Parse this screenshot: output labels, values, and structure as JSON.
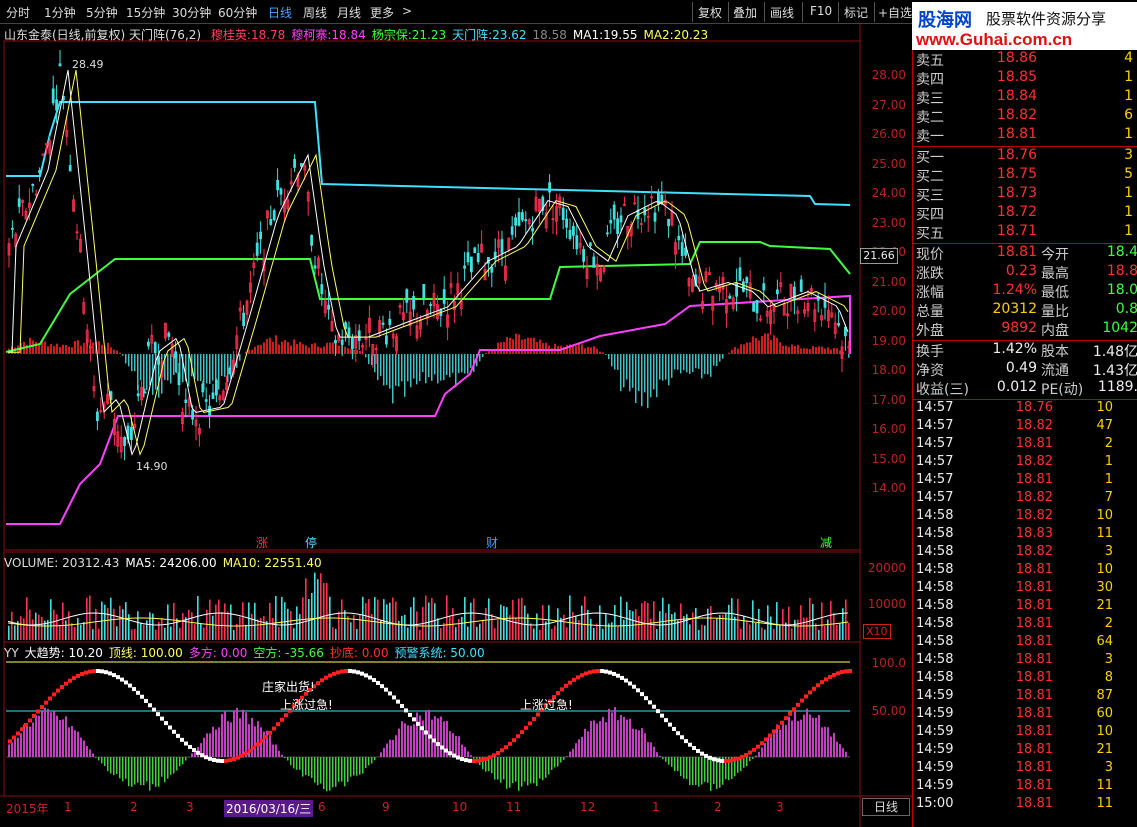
{
  "toolbar": {
    "periods": [
      "分时",
      "1分钟",
      "5分钟",
      "15分钟",
      "30分钟",
      "60分钟",
      "日线",
      "周线",
      "月线",
      "更多"
    ],
    "active_period": "日线",
    "more_arrow": ">",
    "right_buttons": [
      "复权",
      "叠加",
      "画线",
      "F10",
      "标记",
      "+自选"
    ]
  },
  "logo": {
    "brand": "股海网",
    "tagline": "股票软件资源分享",
    "url": "www.Guhai.com.cn"
  },
  "main_chart": {
    "title": "山东金泰(日线,前复权) 天门阵(76,2)",
    "indicators": [
      {
        "label": "穆桂英:",
        "value": "18.78",
        "color": "#ff4060"
      },
      {
        "label": "穆柯寨:",
        "value": "18.84",
        "color": "#ff40ff"
      },
      {
        "label": "杨宗保:",
        "value": "21.23",
        "color": "#40ff40"
      },
      {
        "label": "天门阵:",
        "value": "23.62",
        "color": "#40e0ff"
      },
      {
        "label": "",
        "value": "18.58",
        "color": "#888888"
      },
      {
        "label": "MA1:",
        "value": "19.55",
        "color": "#ffffff"
      },
      {
        "label": "MA2:",
        "value": "20.23",
        "color": "#ffff60"
      }
    ],
    "y_ticks": [
      "28.00",
      "27.00",
      "26.00",
      "25.00",
      "24.00",
      "23.00",
      "22.00",
      "21.00",
      "20.00",
      "19.00",
      "18.00",
      "17.00",
      "16.00",
      "15.00",
      "14.00"
    ],
    "high_mark": "28.49",
    "low_mark": "14.90",
    "current_price_tag": "21.66",
    "event_markers": [
      {
        "text": "涨",
        "color": "#ff3030"
      },
      {
        "text": "停",
        "color": "#40e0ff"
      },
      {
        "text": "财",
        "color": "#40a0ff"
      },
      {
        "text": "减",
        "color": "#40ff40"
      }
    ]
  },
  "volume_chart": {
    "labels": [
      {
        "text": "VOLUME: 20312.43",
        "color": "#dddddd"
      },
      {
        "text": "MA5: 24206.00",
        "color": "#ffffff"
      },
      {
        "text": "MA10: 22551.40",
        "color": "#ffff60"
      }
    ],
    "y_ticks": [
      "20000",
      "10000"
    ],
    "unit": "X10"
  },
  "yy_chart": {
    "labels": [
      {
        "text": "YY",
        "color": "#dddddd"
      },
      {
        "text": "大趋势: 10.20",
        "color": "#ffffff"
      },
      {
        "text": "顶线: 100.00",
        "color": "#ffff60"
      },
      {
        "text": "多方: 0.00",
        "color": "#ff40ff"
      },
      {
        "text": "空方: -35.66",
        "color": "#40ff40"
      },
      {
        "text": "抄底: 0.00",
        "color": "#ff3030"
      },
      {
        "text": "预警系统: 50.00",
        "color": "#40e0ff"
      }
    ],
    "y_ticks": [
      "100.0",
      "50.00"
    ],
    "annotations": [
      "庄家出货!",
      "上涨过急!",
      "上涨过急!"
    ]
  },
  "time_axis": {
    "labels": [
      "2015年",
      "1",
      "2",
      "3",
      "2016/03/16/三",
      "6",
      "9",
      "10",
      "11",
      "12",
      "1",
      "2",
      "3"
    ],
    "period_button": "日线"
  },
  "quote": {
    "asks": [
      {
        "label": "卖五",
        "price": "18.86",
        "vol": "4"
      },
      {
        "label": "卖四",
        "price": "18.85",
        "vol": "1"
      },
      {
        "label": "卖三",
        "price": "18.84",
        "vol": "1"
      },
      {
        "label": "卖二",
        "price": "18.82",
        "vol": "6"
      },
      {
        "label": "卖一",
        "price": "18.81",
        "vol": "1"
      }
    ],
    "bids": [
      {
        "label": "买一",
        "price": "18.76",
        "vol": "3"
      },
      {
        "label": "买二",
        "price": "18.75",
        "vol": "5"
      },
      {
        "label": "买三",
        "price": "18.73",
        "vol": "1"
      },
      {
        "label": "买四",
        "price": "18.72",
        "vol": "1"
      },
      {
        "label": "买五",
        "price": "18.71",
        "vol": "1"
      }
    ],
    "stats": [
      {
        "l1": "现价",
        "v1": "18.81",
        "c1": "#ff3030",
        "l2": "今开",
        "v2": "18.4",
        "c2": "#40ff40"
      },
      {
        "l1": "涨跌",
        "v1": "0.23",
        "c1": "#ff3030",
        "l2": "最高",
        "v2": "18.8",
        "c2": "#ff3030"
      },
      {
        "l1": "涨幅",
        "v1": "1.24%",
        "c1": "#ff3030",
        "l2": "最低",
        "v2": "18.0",
        "c2": "#40ff40"
      },
      {
        "l1": "总量",
        "v1": "20312",
        "c1": "#ffd000",
        "l2": "量比",
        "v2": "0.8",
        "c2": "#40ff40"
      },
      {
        "l1": "外盘",
        "v1": "9892",
        "c1": "#ff3030",
        "l2": "内盘",
        "v2": "1042",
        "c2": "#40ff40"
      }
    ],
    "stats2": [
      {
        "l1": "换手",
        "v1": "1.42%",
        "l2": "股本",
        "v2": "1.48亿"
      },
      {
        "l1": "净资",
        "v1": "0.49",
        "l2": "流通",
        "v2": "1.43亿"
      },
      {
        "l1": "收益(三)",
        "v1": "0.012",
        "l2": "PE(动)",
        "v2": "1189."
      }
    ],
    "ticks": [
      {
        "time": "14:57",
        "price": "18.76",
        "vol": "10",
        "dir": "S"
      },
      {
        "time": "14:57",
        "price": "18.82",
        "vol": "47",
        "dir": "B"
      },
      {
        "time": "14:57",
        "price": "18.81",
        "vol": "2",
        "dir": "S"
      },
      {
        "time": "14:57",
        "price": "18.82",
        "vol": "1",
        "dir": "B"
      },
      {
        "time": "14:57",
        "price": "18.81",
        "vol": "1",
        "dir": "S"
      },
      {
        "time": "14:57",
        "price": "18.82",
        "vol": "7",
        "dir": "B"
      },
      {
        "time": "14:58",
        "price": "18.82",
        "vol": "10",
        "dir": "B"
      },
      {
        "time": "14:58",
        "price": "18.83",
        "vol": "11",
        "dir": "B"
      },
      {
        "time": "14:58",
        "price": "18.82",
        "vol": "3",
        "dir": "S"
      },
      {
        "time": "14:58",
        "price": "18.81",
        "vol": "10",
        "dir": "S"
      },
      {
        "time": "14:58",
        "price": "18.81",
        "vol": "30",
        "dir": "S"
      },
      {
        "time": "14:58",
        "price": "18.81",
        "vol": "21",
        "dir": "S"
      },
      {
        "time": "14:58",
        "price": "18.81",
        "vol": "2",
        "dir": "S"
      },
      {
        "time": "14:58",
        "price": "18.81",
        "vol": "64",
        "dir": "S"
      },
      {
        "time": "14:58",
        "price": "18.81",
        "vol": "3",
        "dir": "S"
      },
      {
        "time": "14:58",
        "price": "18.81",
        "vol": "8",
        "dir": "S"
      },
      {
        "time": "14:59",
        "price": "18.81",
        "vol": "87",
        "dir": "B"
      },
      {
        "time": "14:59",
        "price": "18.81",
        "vol": "60",
        "dir": "B"
      },
      {
        "time": "14:59",
        "price": "18.81",
        "vol": "10",
        "dir": "B"
      },
      {
        "time": "14:59",
        "price": "18.81",
        "vol": "21",
        "dir": "B"
      },
      {
        "time": "14:59",
        "price": "18.81",
        "vol": "3",
        "dir": "B"
      },
      {
        "time": "14:59",
        "price": "18.81",
        "vol": "11",
        "dir": "S"
      },
      {
        "time": "15:00",
        "price": "18.81",
        "vol": "11",
        "dir": "S"
      }
    ]
  }
}
